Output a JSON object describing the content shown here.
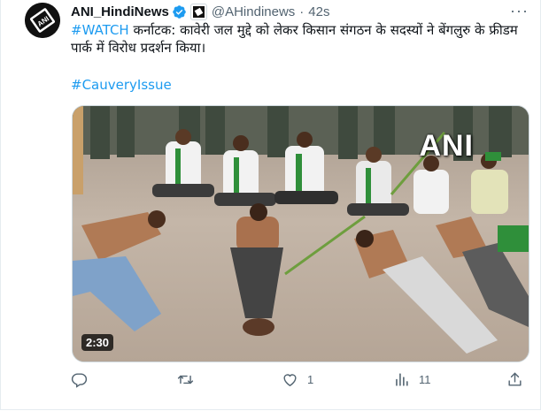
{
  "tweet": {
    "author_name": "ANI_HindiNews",
    "handle": "@AHindinews",
    "separator": "·",
    "time": "42s",
    "more_label": "···",
    "text_tag": "#WATCH",
    "text_body": " कर्नाटक: कावेरी जल मुद्दे को लेकर किसान संगठन के सदस्यों ने बेंगलुरु के फ्रीडम पार्क में विरोध प्रदर्शन किया।",
    "hashtag": "#CauveryIssue"
  },
  "media": {
    "duration": "2:30",
    "watermark": "ANI"
  },
  "actions": {
    "reply_count": "",
    "retweet_count": "",
    "like_count": "1",
    "views_count": "11"
  },
  "colors": {
    "accent": "#1d9bf0",
    "secondary_text": "#536471",
    "verified": "#1d9bf0"
  },
  "icons": [
    "verified-badge-icon",
    "affiliate-icon",
    "reply-icon",
    "retweet-icon",
    "like-icon",
    "views-icon",
    "share-icon"
  ]
}
